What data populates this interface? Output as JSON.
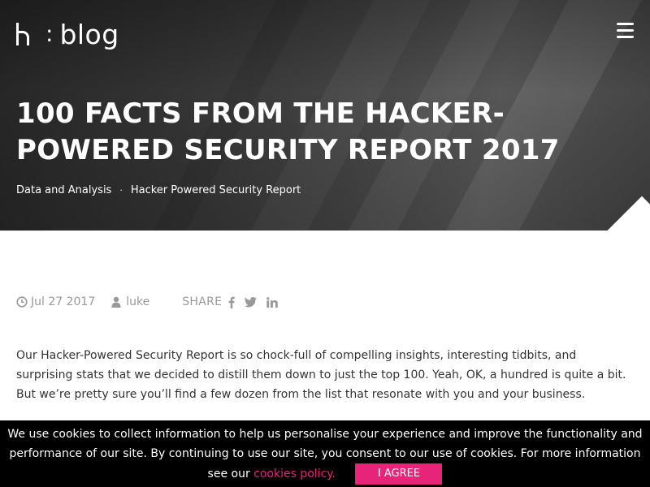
{
  "header": {
    "logo_colon": ":",
    "logo_word": "blog",
    "menu_icon": "hamburger-menu-icon"
  },
  "article": {
    "title_line1": "100 FACTS FROM THE HACKER-",
    "title_line2": "POWERED SECURITY REPORT 2017",
    "tags": [
      "Data and Analysis",
      "Hacker Powered Security Report"
    ],
    "tag_separator": "·",
    "date": "Jul 27 2017",
    "author": "luke",
    "share_label": "SHARE",
    "share_icons": [
      "facebook-icon",
      "twitter-icon",
      "linkedin-icon"
    ],
    "intro": "Our Hacker-Powered Security Report is so chock-full of compelling insights, interesting tidbits, and surprising stats that we decided to distill them down to just the top 100. Yeah, OK, a hundred is quite a bit. But we’re pretty sure you’ll find a few dozen from the list that resonate with you and your business."
  },
  "cookie_banner": {
    "line1": "We use cookies to collect information to help us personalise your experience and improve the functionality and",
    "line2": "performance of our site. By continuing to use our site, you consent to our use of cookies. For more information",
    "line3_prefix": "see our",
    "link_text": "cookies policy.",
    "agree_label": "I AGREE"
  },
  "colors": {
    "accent": "#e8237a",
    "meta_gray": "#999999",
    "banner_bg": "#000000"
  }
}
